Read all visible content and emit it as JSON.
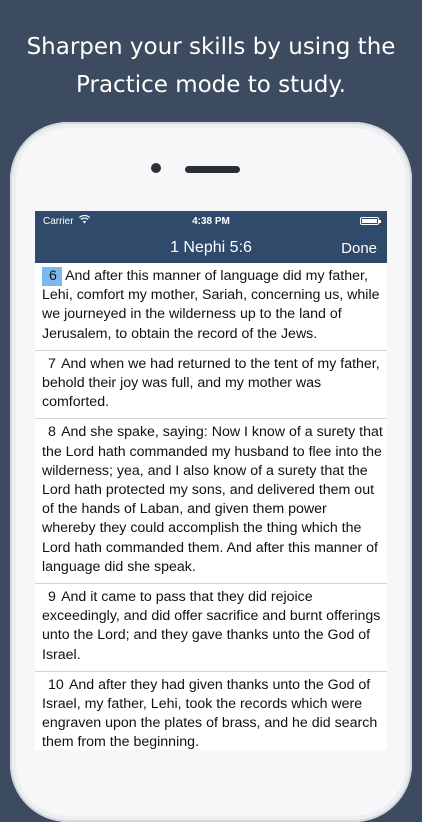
{
  "headline": {
    "line1": "Sharpen your skills by using the",
    "line2": "Practice mode to study."
  },
  "status_bar": {
    "carrier": "Carrier",
    "time": "4:38 PM"
  },
  "nav": {
    "title": "1 Nephi 5:6",
    "done_label": "Done"
  },
  "verses": [
    {
      "num": "6",
      "text": "And after this manner of language did my father, Lehi, comfort my mother, Sariah, concerning us, while we journeyed in the wilderness up to the land of Jerusalem, to obtain the record of the Jews.",
      "highlighted": true
    },
    {
      "num": "7",
      "text": "And when we had returned to the tent of my father, behold their joy was full, and my mother was comforted."
    },
    {
      "num": "8",
      "text": "And she spake, saying: Now I know of a surety that the Lord hath commanded my husband to flee into the wilderness; yea, and I also know of a surety that the Lord hath protected my sons, and delivered them out of the hands of Laban, and given them power whereby they could accomplish the thing which the Lord hath commanded them. And after this manner of language did she speak."
    },
    {
      "num": "9",
      "text": "And it came to pass that they did rejoice exceedingly, and did offer sacrifice and burnt offerings unto the Lord; and they gave thanks unto the God of Israel."
    },
    {
      "num": "10",
      "text": "And after they had given thanks unto the God of Israel, my father, Lehi, took the records which were engraven upon the plates of brass, and he did search them from the beginning."
    }
  ],
  "colors": {
    "background": "#3c4b5f",
    "nav_bar": "#2f4a6b",
    "verse_highlight": "#7ab8ee"
  },
  "icons": {
    "wifi": "wifi-icon",
    "battery": "battery-icon"
  }
}
